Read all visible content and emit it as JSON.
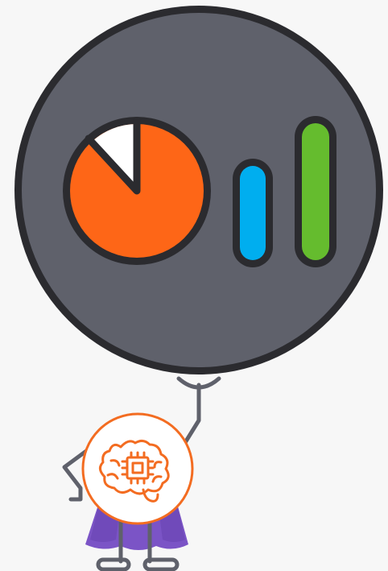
{
  "illustration": {
    "icons": {
      "balloon": "balloon-icon",
      "pie": "pie-chart-icon",
      "bars": "bar-chart-icon",
      "brain": "ai-brain-chip-icon",
      "mascot": "mascot-character"
    },
    "colors": {
      "background": "#f7f7f7",
      "balloon_fill": "#5f616b",
      "outline": "#2b2b2f",
      "pie_main": "#fe6617",
      "pie_slice": "#ffffff",
      "bar_blue": "#00aeef",
      "bar_green": "#65bc2e",
      "cape": "#7b54c6",
      "cape_shadow": "#5c39a3",
      "badge_ring": "#f36c21",
      "badge_fill": "#ffffff",
      "limb": "#5f616b"
    }
  }
}
